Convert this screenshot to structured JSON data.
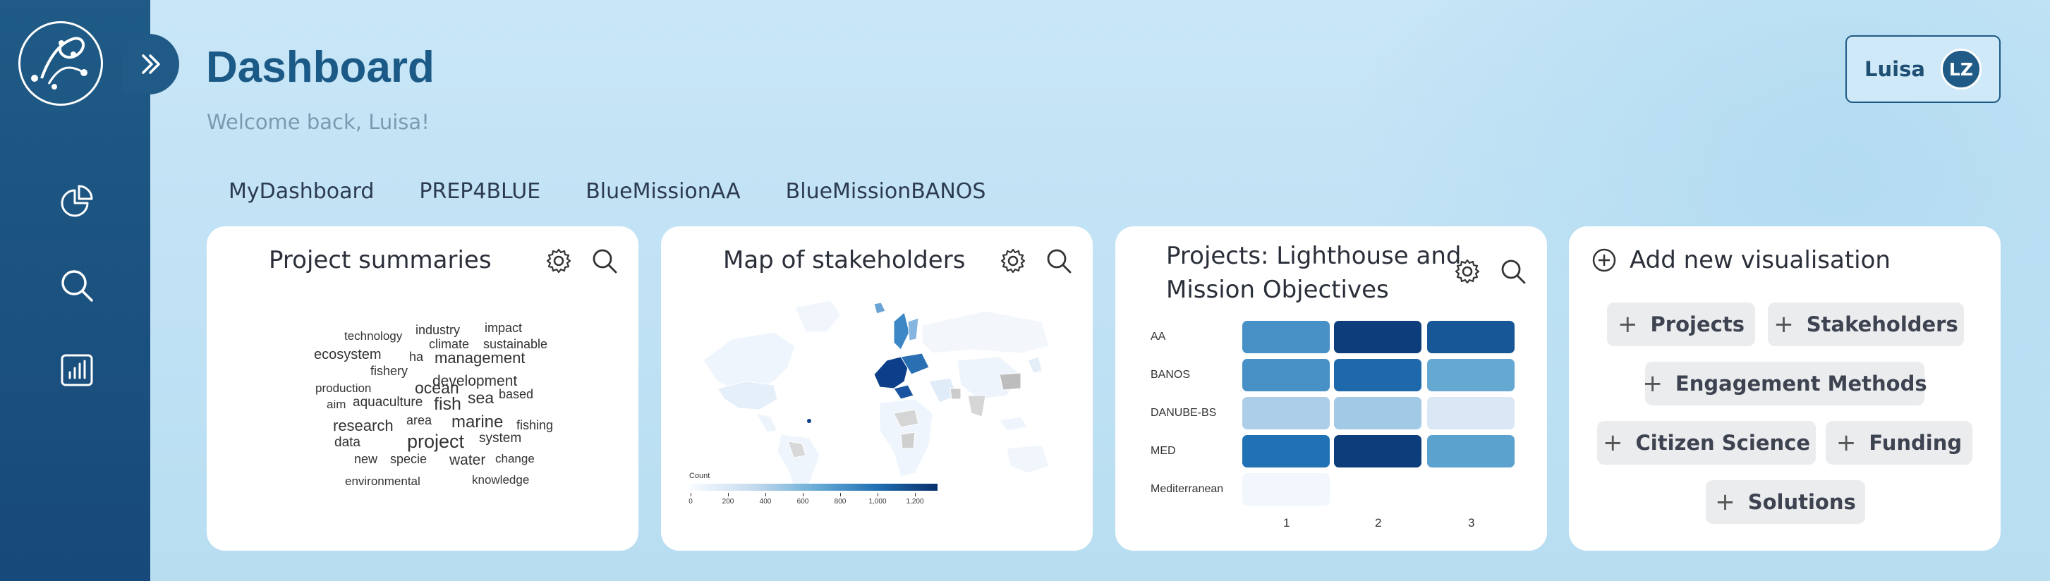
{
  "header": {
    "title": "Dashboard",
    "subtitle": "Welcome back, Luisa!"
  },
  "user": {
    "name": "Luisa",
    "initials": "LZ"
  },
  "tabs": [
    "MyDashboard",
    "PREP4BLUE",
    "BlueMissionAA",
    "BlueMissionBANOS"
  ],
  "cards": {
    "summaries": {
      "title": "Project summaries",
      "words": [
        "technology",
        "industry",
        "impact",
        "climate",
        "sustainable",
        "ecosystem",
        "ha",
        "management",
        "fishery",
        "development",
        "production",
        "ocean",
        "aim",
        "aquaculture",
        "fish",
        "sea",
        "based",
        "research",
        "area",
        "marine",
        "fishing",
        "data",
        "project",
        "system",
        "new",
        "specie",
        "water",
        "change",
        "environmental",
        "knowledge"
      ]
    },
    "map": {
      "title": "Map of stakeholders",
      "legend_title": "Count",
      "legend_ticks": [
        "0",
        "200",
        "400",
        "600",
        "800",
        "1,000",
        "1,200"
      ]
    },
    "heatmap": {
      "title_line1": "Projects: Lighthouse and",
      "title_line2": "Mission Objectives",
      "chart_data": {
        "type": "heatmap",
        "rows": [
          "AA",
          "BANOS",
          "DANUBE-BS",
          "MED",
          "Mediterranean"
        ],
        "columns": [
          "1",
          "2",
          "3"
        ],
        "values": [
          [
            0.62,
            0.95,
            0.85
          ],
          [
            0.62,
            0.78,
            0.52
          ],
          [
            0.32,
            0.35,
            0.15
          ],
          [
            0.75,
            0.95,
            0.55
          ],
          [
            0.03,
            null,
            null
          ]
        ]
      }
    },
    "add": {
      "title": "Add new visualisation",
      "chips": [
        "Projects",
        "Stakeholders",
        "Engagement Methods",
        "Citizen Science",
        "Funding",
        "Solutions"
      ]
    }
  },
  "colors": {
    "sidebar": "#1f5b86",
    "accent": "#1b5a86"
  }
}
